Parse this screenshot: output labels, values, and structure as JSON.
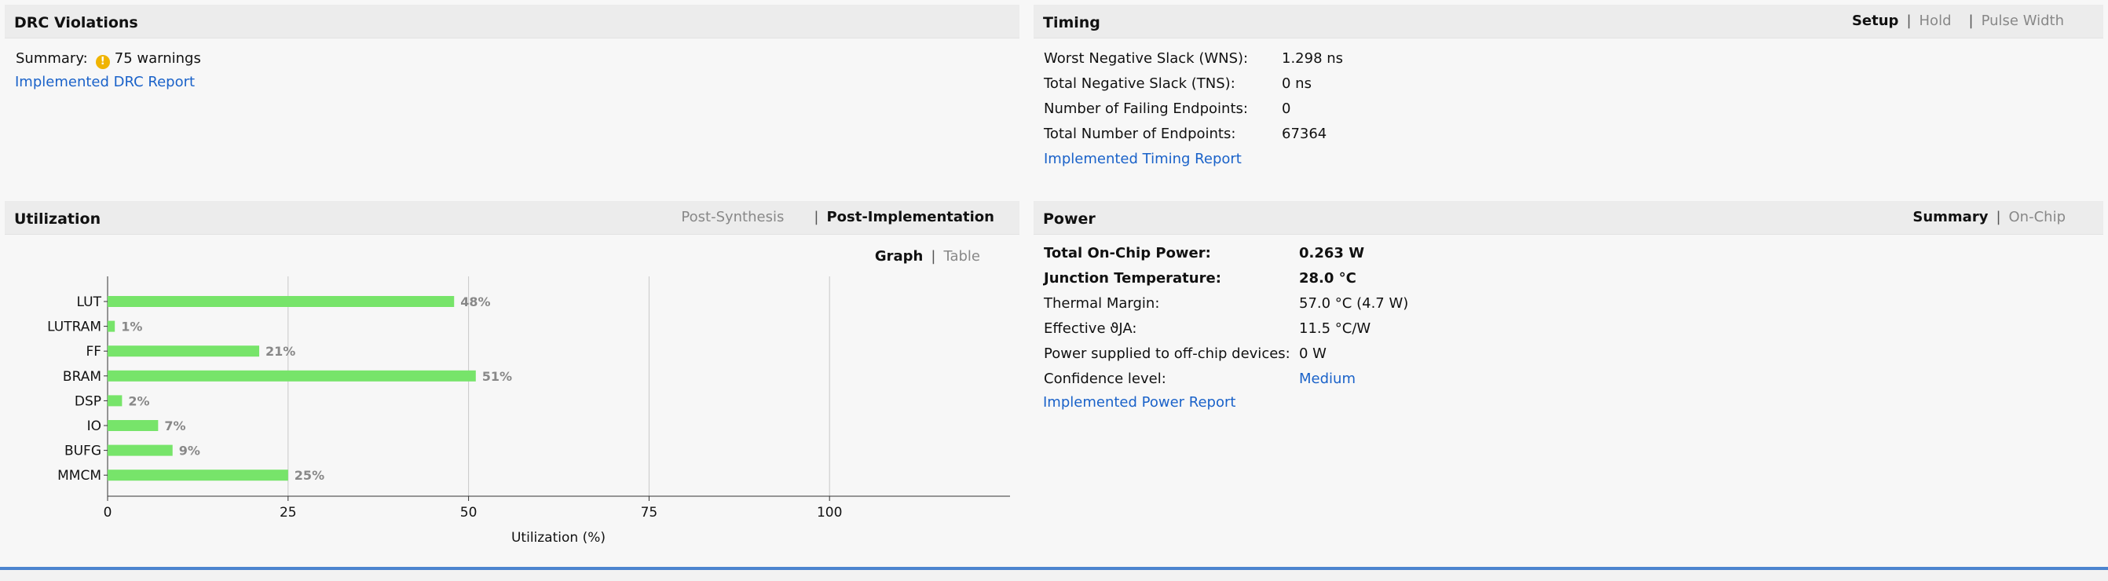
{
  "drc": {
    "title": "DRC Violations",
    "summary_label": "Summary:",
    "icon": "warning-icon",
    "summary_value": "75 warnings",
    "report_link": "Implemented DRC Report"
  },
  "timing": {
    "title": "Timing",
    "tabs": [
      "Setup",
      "Hold",
      "Pulse Width"
    ],
    "active_tab": "Setup",
    "rows": [
      {
        "label": "Worst Negative Slack (WNS):",
        "value": "1.298 ns"
      },
      {
        "label": "Total Negative Slack (TNS):",
        "value": "0 ns"
      },
      {
        "label": "Number of Failing Endpoints:",
        "value": "0"
      },
      {
        "label": "Total Number of Endpoints:",
        "value": "67364"
      }
    ],
    "report_link": "Implemented Timing Report"
  },
  "utilization": {
    "title": "Utilization",
    "tabs": [
      "Post-Synthesis",
      "Post-Implementation"
    ],
    "active_tab": "Post-Implementation",
    "view_tabs": [
      "Graph",
      "Table"
    ],
    "active_view": "Graph",
    "bar_color": "#77e46a"
  },
  "power": {
    "title": "Power",
    "tabs": [
      "Summary",
      "On-Chip"
    ],
    "active_tab": "Summary",
    "rows": [
      {
        "label": "Total On-Chip Power:",
        "value": "0.263 W",
        "bold": true
      },
      {
        "label": "Junction Temperature:",
        "value": "28.0 °C",
        "bold": true
      },
      {
        "label": "Thermal Margin:",
        "value": "57.0 °C (4.7 W)",
        "bold": false
      },
      {
        "label": "Effective ϑJA:",
        "value": "11.5 °C/W",
        "bold": false
      },
      {
        "label": "Power supplied to off-chip devices:",
        "value": "0 W",
        "bold": false
      },
      {
        "label": "Confidence level:",
        "value": "Medium",
        "bold": false,
        "link": true
      }
    ],
    "report_link": "Implemented Power Report"
  },
  "colors": {
    "link": "#1a62c9",
    "header_bg": "#ececec",
    "accent_line": "#4d84cf"
  },
  "chart_data": {
    "type": "bar",
    "orientation": "horizontal",
    "categories": [
      "LUT",
      "LUTRAM",
      "FF",
      "BRAM",
      "DSP",
      "IO",
      "BUFG",
      "MMCM"
    ],
    "values": [
      48,
      1,
      21,
      51,
      2,
      7,
      9,
      25
    ],
    "value_labels": [
      "48%",
      "1%",
      "21%",
      "51%",
      "2%",
      "7%",
      "9%",
      "25%"
    ],
    "xlabel": "Utilization (%)",
    "ylabel": "",
    "xlim": [
      0,
      125
    ],
    "xticks": [
      0,
      25,
      50,
      75,
      100
    ],
    "grid": true
  }
}
